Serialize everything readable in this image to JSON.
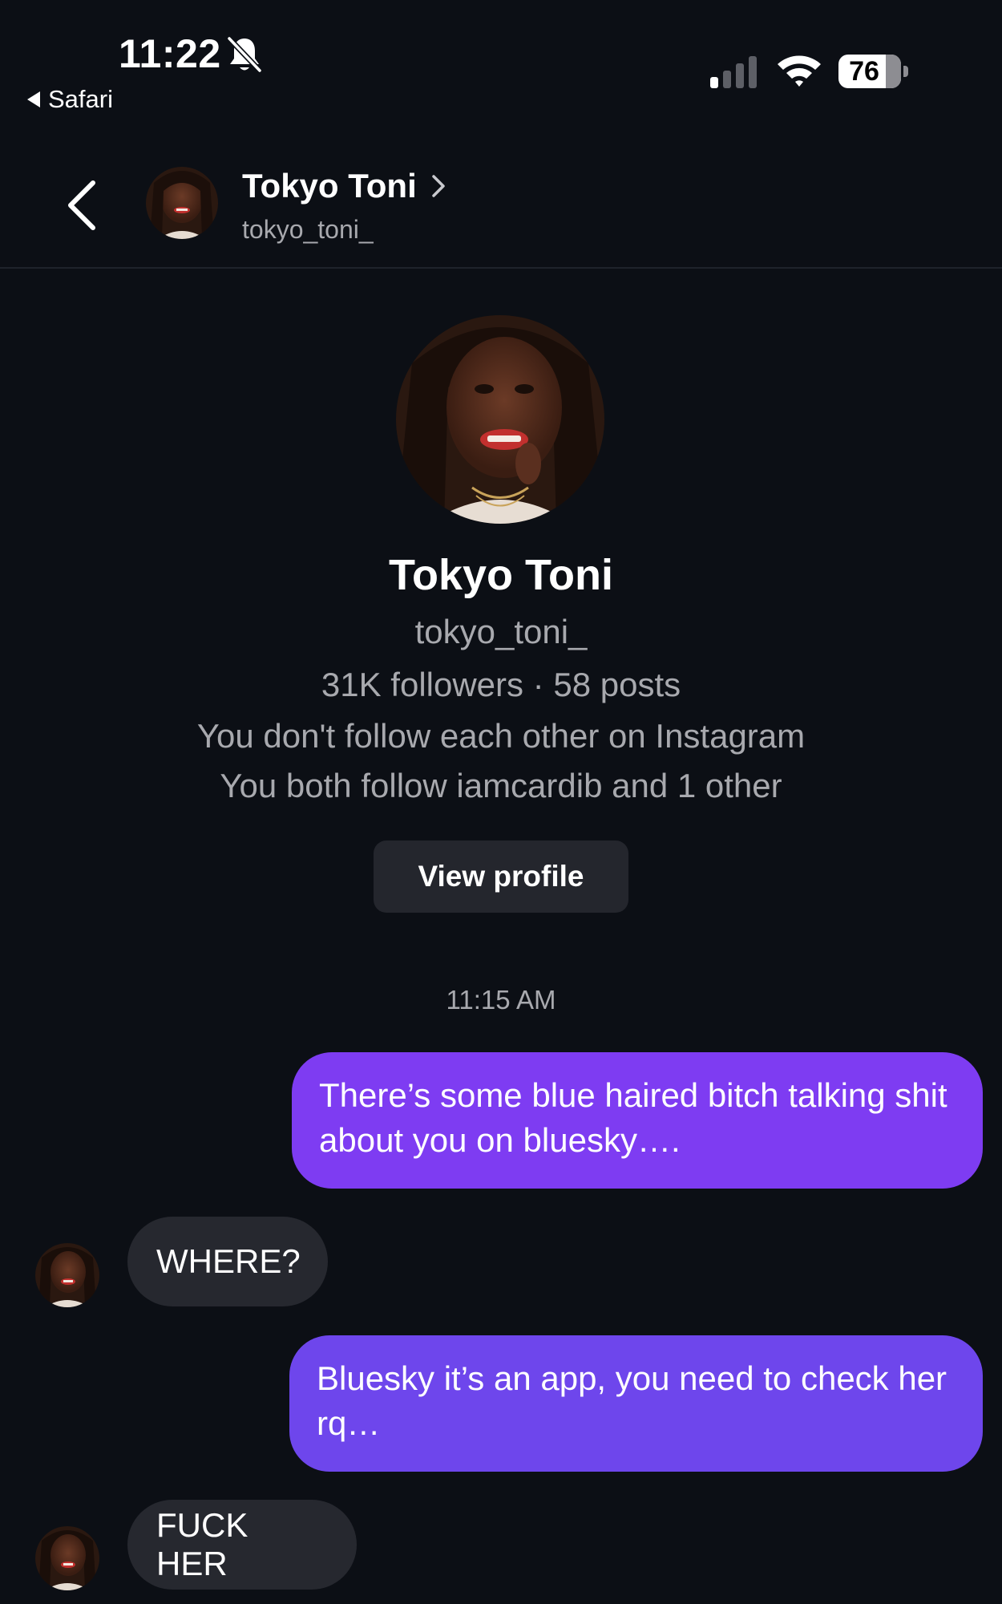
{
  "status_bar": {
    "time": "11:22",
    "back_app": "Safari",
    "battery_percent": "76",
    "battery_level": 0.76
  },
  "header": {
    "name": "Tokyo Toni",
    "handle": "tokyo_toni_"
  },
  "profile": {
    "name": "Tokyo Toni",
    "handle": "tokyo_toni_",
    "stats": "31K followers · 58 posts",
    "follow_status": "You don't follow each other on Instagram",
    "mutual": "You both follow iamcardib and 1 other",
    "view_profile_label": "View profile"
  },
  "conversation": {
    "timestamp": "11:15 AM",
    "messages": [
      {
        "direction": "outgoing",
        "text": "There’s some blue haired bitch talking shit about you on bluesky…."
      },
      {
        "direction": "incoming",
        "text": "WHERE?"
      },
      {
        "direction": "outgoing",
        "text": "Bluesky it’s an app, you need to check her rq…"
      },
      {
        "direction": "incoming",
        "text": "FUCK HER"
      }
    ]
  },
  "colors": {
    "background": "#0c0f15",
    "outgoing_bubble_1": "#7e3cf2",
    "outgoing_bubble_2": "#6e46ec",
    "incoming_bubble": "#26282f",
    "secondary_text": "#a8a9ae"
  }
}
